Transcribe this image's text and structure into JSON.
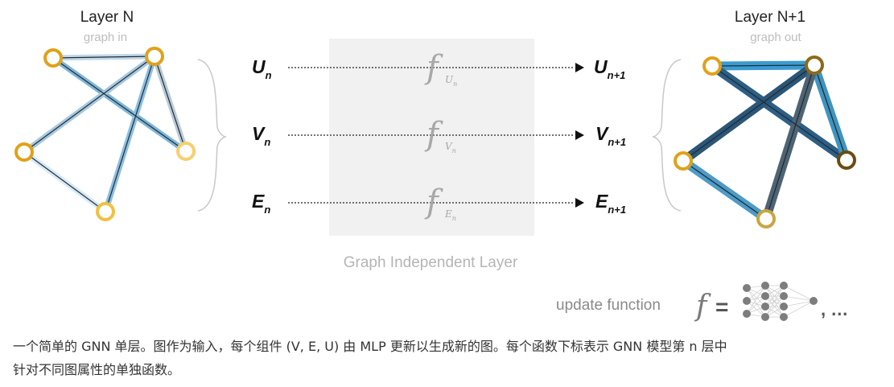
{
  "left_graph": {
    "title": "Layer N",
    "subtitle": "graph in"
  },
  "right_graph": {
    "title": "Layer N+1",
    "subtitle": "graph out"
  },
  "rows": [
    {
      "input_main": "U",
      "input_sub": "n",
      "f_sub_main": "U",
      "f_sub_sub": "n",
      "output_main": "U",
      "output_sub": "n+1"
    },
    {
      "input_main": "V",
      "input_sub": "n",
      "f_sub_main": "V",
      "f_sub_sub": "n",
      "output_main": "V",
      "output_sub": "n+1"
    },
    {
      "input_main": "E",
      "input_sub": "n",
      "f_sub_main": "E",
      "f_sub_sub": "n",
      "output_main": "E",
      "output_sub": "n+1"
    }
  ],
  "function_symbol": "f",
  "middle_label": "Graph Independent Layer",
  "legend": {
    "label": "update function",
    "symbol": "f",
    "equals": "=",
    "trailing": ", …"
  },
  "caption": {
    "line1": "一个简单的 GNN 单层。图作为输入，每个组件 (V, E, U) 由 MLP 更新以生成新的图。每个函数下标表示 GNN 模型第 n 层中",
    "line2": "针对不同图属性的单独函数。"
  },
  "colors": {
    "node_orange": "#e0a21a",
    "node_light": "#f6cf6e",
    "node_dark": "#7d5b14",
    "edge_light": "#9ecae1",
    "edge_dark": "#2b5c80",
    "box_fill": "#f1f1f1",
    "muted_text": "#b0b0b0"
  }
}
